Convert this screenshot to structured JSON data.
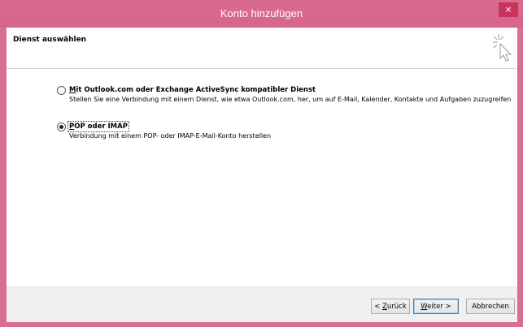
{
  "window": {
    "title": "Konto hinzufügen",
    "close_glyph": "×",
    "accent": "#d86e93"
  },
  "header": {
    "title": "Dienst auswählen",
    "icon": "wizard-cursor-icon"
  },
  "options": [
    {
      "label_mnemonic": "M",
      "label_rest": "it Outlook.com oder Exchange ActiveSync kompatibler Dienst",
      "description": "Stellen Sie eine Verbindung mit einem Dienst, wie etwa Outlook.com, her, um auf E-Mail, Kalender, Kontakte und Aufgaben zuzugreifen",
      "checked": false
    },
    {
      "label_mnemonic": "P",
      "label_rest": "OP oder IMAP",
      "description": "Verbindung mit einem POP- oder IMAP-E-Mail-Konto herstellen",
      "checked": true
    }
  ],
  "footer": {
    "back_prefix": "< ",
    "back_mnemonic": "Z",
    "back_rest": "urück",
    "next_mnemonic": "W",
    "next_rest": "eiter >",
    "cancel_label": "Abbrechen"
  }
}
